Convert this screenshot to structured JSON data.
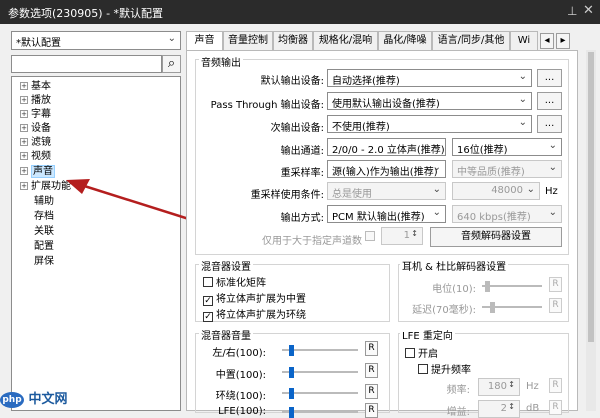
{
  "window": {
    "title": "参数选项(230905) - *默认配置",
    "pin": "⊥",
    "close": "✕"
  },
  "profile": {
    "value": "*默认配置"
  },
  "search": {
    "placeholder": "",
    "icon": "⌕"
  },
  "tree": {
    "items": [
      {
        "label": "基本",
        "expand": "+"
      },
      {
        "label": "播放",
        "expand": "+"
      },
      {
        "label": "字幕",
        "expand": "+"
      },
      {
        "label": "设备",
        "expand": "+"
      },
      {
        "label": "滤镜",
        "expand": "+"
      },
      {
        "label": "视频",
        "expand": "+"
      },
      {
        "label": "声音",
        "expand": "+"
      },
      {
        "label": "扩展功能",
        "expand": "+"
      },
      {
        "label": "辅助",
        "expand": ""
      },
      {
        "label": "存档",
        "expand": ""
      },
      {
        "label": "关联",
        "expand": ""
      },
      {
        "label": "配置",
        "expand": ""
      },
      {
        "label": "屏保",
        "expand": ""
      }
    ]
  },
  "tabs": [
    "声音",
    "音量控制",
    "均衡器",
    "规格化/混响",
    "晶化/降噪",
    "语言/同步/其他",
    "Wi"
  ],
  "tab_nav": {
    "prev": "◂",
    "next": "▸"
  },
  "audio_output": {
    "title": "音频输出",
    "default_device": {
      "label": "默认输出设备:",
      "value": "自动选择(推荐)",
      "btn": "..."
    },
    "passthrough": {
      "label": "Pass Through 输出设备:",
      "value": "使用默认输出设备(推荐)",
      "btn": "..."
    },
    "secondary": {
      "label": "次输出设备:",
      "value": "不使用(推荐)",
      "btn": "..."
    },
    "channels": {
      "label": "输出通道:",
      "value": "2/0/0 - 2.0 立体声(推荐)",
      "bits": "16位(推荐)"
    },
    "resampler": {
      "label": "重采样率:",
      "value": "源(输入)作为输出(推荐)",
      "quality": "中等品质(推荐)"
    },
    "resample_cond": {
      "label": "重采样使用条件:",
      "value": "总是使用",
      "rate": "48000",
      "unit": "Hz"
    },
    "output_mode": {
      "label": "输出方式:",
      "value": "PCM 默认输出(推荐)",
      "bitrate": "640 kbps(推荐)"
    },
    "only_more": {
      "label": "仅用于大于指定声道数",
      "spin": "1"
    },
    "decoder_btn": "音频解码器设置"
  },
  "mixer": {
    "title": "混音器设置",
    "items": [
      {
        "label": "标准化矩阵",
        "checked": false
      },
      {
        "label": "将立体声扩展为中置",
        "checked": true
      },
      {
        "label": "将立体声扩展为环绕",
        "checked": true
      }
    ]
  },
  "headphone": {
    "title": "耳机 & 杜比解码器设置",
    "level": {
      "label": "电位(10):",
      "r": "R"
    },
    "delay": {
      "label": "延迟(70毫秒):",
      "r": "R"
    }
  },
  "mixer_vol": {
    "title": "混音器音量",
    "rows": [
      {
        "label": "左/右(100):",
        "r": "R"
      },
      {
        "label": "中置(100):",
        "r": "R"
      },
      {
        "label": "环绕(100):",
        "r": "R"
      },
      {
        "label": "LFE(100):",
        "r": "R"
      }
    ]
  },
  "lfe": {
    "title": "LFE 重定向",
    "enable": "开启",
    "boost": "提升频率",
    "freq": {
      "label": "频率:",
      "value": "180",
      "unit": "Hz",
      "r": "R"
    },
    "gain": {
      "label": "增益:",
      "value": "2",
      "unit": "dB",
      "r": "R"
    }
  },
  "watermark": "中文网"
}
